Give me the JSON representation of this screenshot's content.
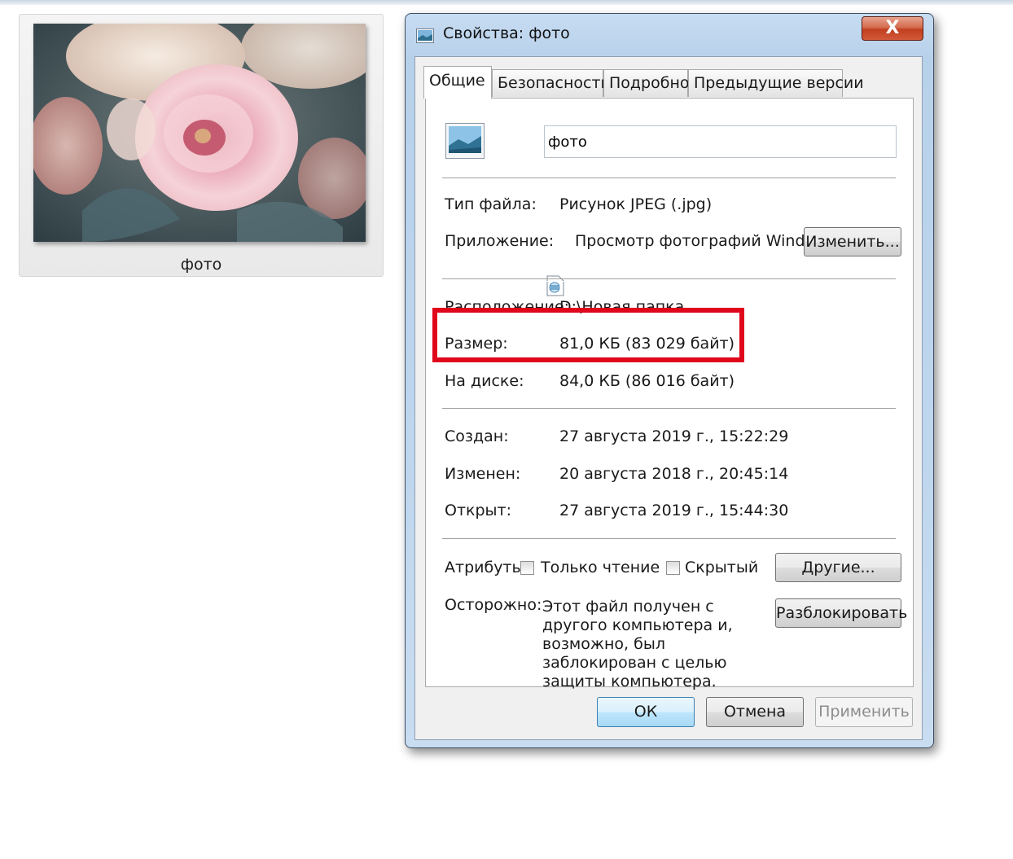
{
  "explorer": {
    "thumbnail_label": "фото"
  },
  "dialog": {
    "title": "Свойства: фото",
    "close_glyph": "X",
    "tabs": [
      {
        "label": "Общие"
      },
      {
        "label": "Безопасность"
      },
      {
        "label": "Подробно"
      },
      {
        "label": "Предыдущие версии"
      }
    ],
    "file_name": "фото",
    "file_type": {
      "label": "Тип файла:",
      "value": "Рисунок JPEG (.jpg)"
    },
    "application": {
      "label": "Приложение:",
      "value": "Просмотр фотографий Windows",
      "change_button": "Изменить..."
    },
    "location": {
      "label": "Расположение:",
      "value": "D:\\Новая папка"
    },
    "size": {
      "label": "Размер:",
      "value": "81,0 КБ (83 029 байт)"
    },
    "size_on_disk": {
      "label": "На диске:",
      "value": "84,0 КБ (86 016 байт)"
    },
    "created": {
      "label": "Создан:",
      "value": "27 августа 2019 г., 15:22:29"
    },
    "modified": {
      "label": "Изменен:",
      "value": "20 августа 2018 г., 20:45:14"
    },
    "accessed": {
      "label": "Открыт:",
      "value": "27 августа 2019 г., 15:44:30"
    },
    "attributes": {
      "label": "Атрибуты:",
      "readonly": "Только чтение",
      "hidden": "Скрытый",
      "other_button": "Другие..."
    },
    "warning": {
      "label": "Осторожно:",
      "text": "Этот файл получен с другого компьютера и, возможно, был заблокирован с целью защиты компьютера.",
      "unblock_button": "Разблокировать"
    },
    "buttons": {
      "ok": "ОК",
      "cancel": "Отмена",
      "apply": "Применить"
    },
    "highlight_color": "#e0061b"
  }
}
